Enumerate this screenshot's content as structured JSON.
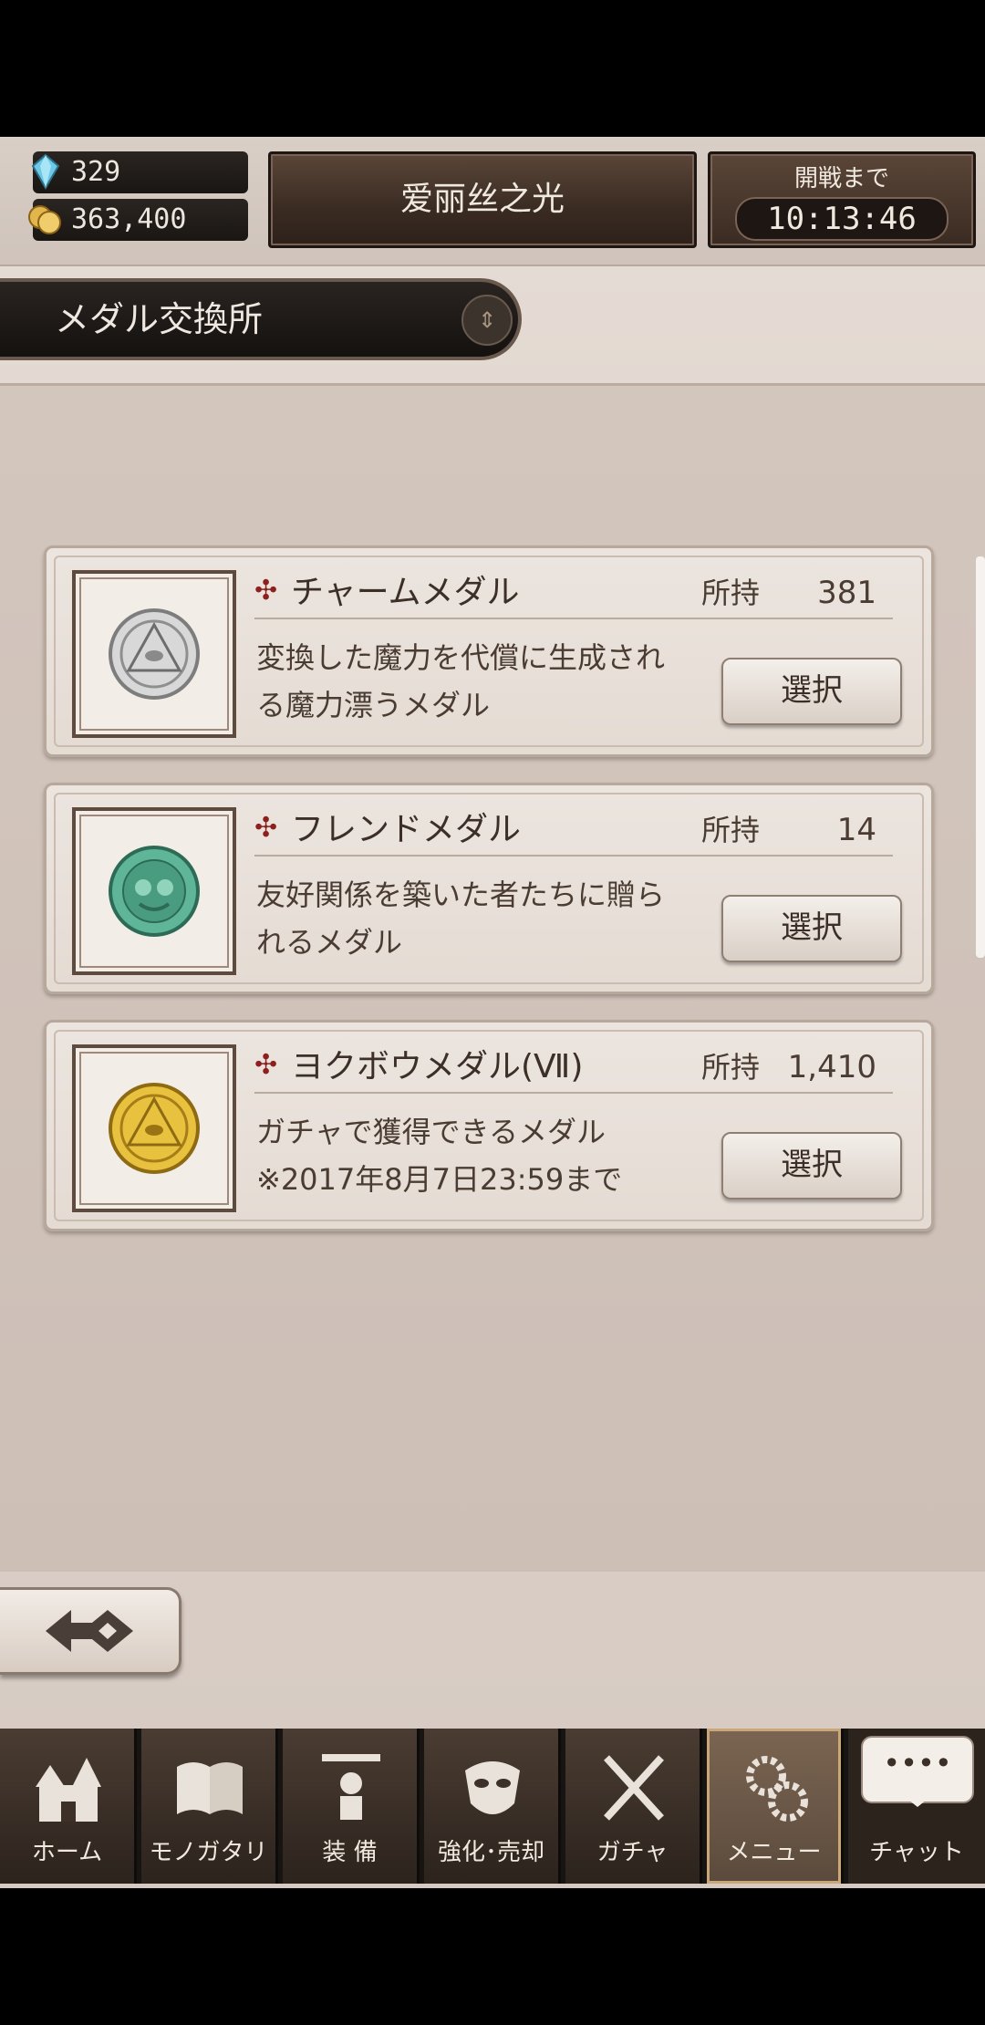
{
  "header": {
    "gems": "329",
    "coins": "363,400",
    "title": "爱丽丝之光",
    "timer_label": "開戦まで",
    "timer_value": "10:13:46"
  },
  "section": {
    "title": "メダル交換所"
  },
  "medals": [
    {
      "name": "チャームメダル",
      "own_label": "所持",
      "own": "381",
      "desc1": "変換した魔力を代償に生成され",
      "desc2": "る魔力漂うメダル",
      "button": "選択",
      "coin_color": "#c9c9c9"
    },
    {
      "name": "フレンドメダル",
      "own_label": "所持",
      "own": "14",
      "desc1": "友好関係を築いた者たちに贈ら",
      "desc2": "れるメダル",
      "button": "選択",
      "coin_color": "#4fa98b"
    },
    {
      "name": "ヨクボウメダル(Ⅶ)",
      "own_label": "所持",
      "own": "1,410",
      "desc1": "ガチャで獲得できるメダル",
      "desc2": "※2017年8月7日23:59まで",
      "button": "選択",
      "coin_color": "#e1b62f"
    }
  ],
  "nav": {
    "home": "ホーム",
    "story": "モノガタリ",
    "equip": "装 備",
    "enhance": "強化･売却",
    "gacha": "ガチャ",
    "menu": "メニュー",
    "chat": "チャット",
    "chat_bubble": "••••"
  }
}
